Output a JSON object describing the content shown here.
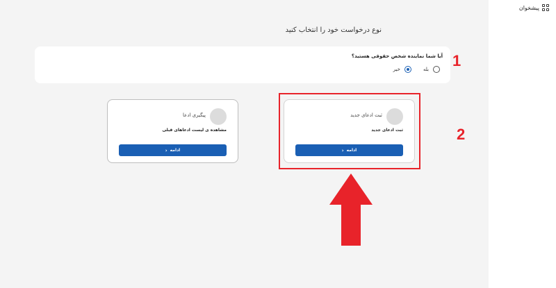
{
  "sidebar": {
    "items": [
      {
        "label": "پیشخوان",
        "icon": "dashboard-grid-icon"
      }
    ]
  },
  "page": {
    "title": "نوع درخواست خود را انتخاب کنید"
  },
  "question": {
    "text": "آیا شما نماینده شخص حقوقی هستید؟",
    "options": [
      {
        "label": "بله",
        "selected": false
      },
      {
        "label": "خیر",
        "selected": true
      }
    ]
  },
  "cards": [
    {
      "title": "ثبت ادعای جدید",
      "description": "ثبت ادعای جدید",
      "button": "ادامه"
    },
    {
      "title": "پیگیری ادعا",
      "description": "مشاهده ی لیست ادعاهای قبلی",
      "button": "ادامه"
    }
  ],
  "annotations": {
    "step1": "1",
    "step2": "2",
    "color": "#e8232a"
  },
  "colors": {
    "primary": "#1a5fb4",
    "background": "#f4f4f4"
  }
}
